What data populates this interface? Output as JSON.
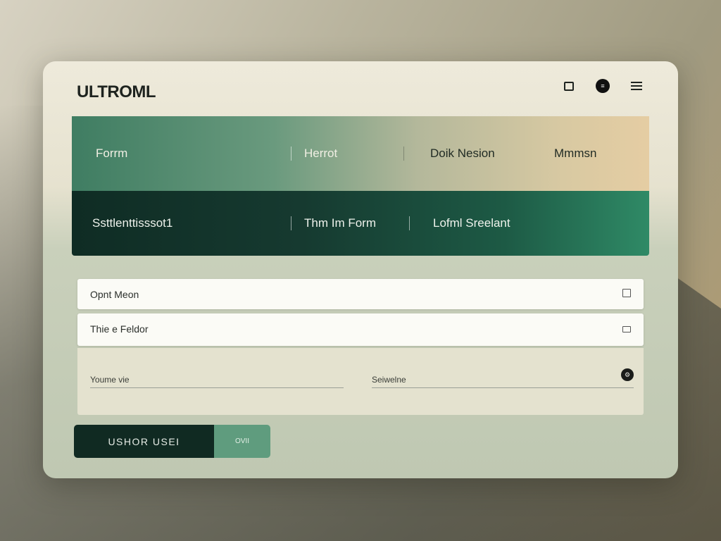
{
  "app": {
    "logo": "ULTROML"
  },
  "header_icons": [
    {
      "name": "window-icon"
    },
    {
      "name": "profile-icon",
      "glyph": "≡"
    },
    {
      "name": "menu-icon"
    }
  ],
  "tabs_row1": [
    {
      "label": "Forrm"
    },
    {
      "label": "Herrot"
    },
    {
      "label": "Doik Nesion"
    },
    {
      "label": "Mmmsn"
    }
  ],
  "tabs_row2": [
    {
      "label": "Ssttlenttisssot1"
    },
    {
      "label": "Thm Im Form"
    },
    {
      "label": "Lofml Sreelant"
    }
  ],
  "fields": [
    {
      "label": "Opnt Meon"
    },
    {
      "label": "Thie e Feldor"
    }
  ],
  "panel": {
    "left_label": "Youme vie",
    "right_label": "Seiwelne",
    "icon_glyph": "⚙"
  },
  "buttons": {
    "primary": "USHOR USEI",
    "secondary": "OVII"
  },
  "colors": {
    "dark_green": "#102a22",
    "accent_green": "#5f9c7e",
    "cream": "#eeeadb"
  }
}
